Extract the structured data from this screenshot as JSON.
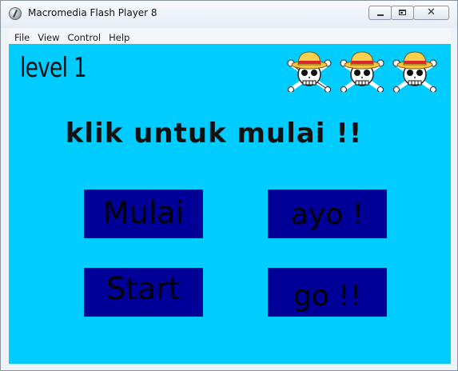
{
  "window": {
    "title": "Macromedia Flash Player 8",
    "minimize_icon": "minimize-icon",
    "maximize_icon": "maximize-icon",
    "close_glyph": "✕",
    "app_icon": "flash-player-icon"
  },
  "menu": {
    "items": [
      {
        "label": "File"
      },
      {
        "label": "View"
      },
      {
        "label": "Control"
      },
      {
        "label": "Help"
      }
    ]
  },
  "stage": {
    "background": "#00ccff",
    "level_text": "level 1",
    "prompt": "klik untuk mulai !!",
    "lives_icon": "straw-hat-skull-icon",
    "lives_count": 3,
    "buttons": [
      {
        "label": "Mulai"
      },
      {
        "label": "ayo !"
      },
      {
        "label": "Start"
      },
      {
        "label": "go !!"
      }
    ],
    "button_color": "#000099"
  }
}
